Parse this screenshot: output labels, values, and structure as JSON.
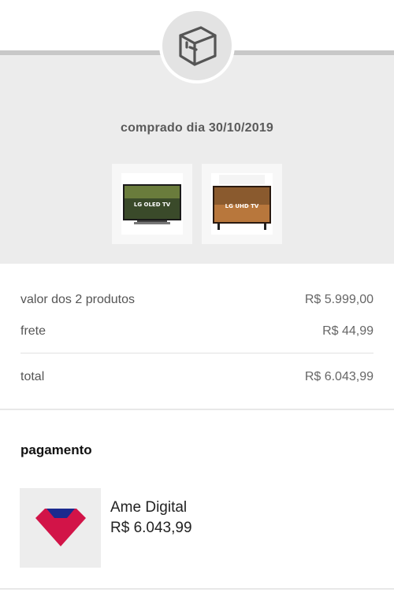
{
  "header": {
    "icon": "package-box-icon",
    "purchase_date": "comprado dia 30/10/2019"
  },
  "products": [
    {
      "name": "LG OLED TV",
      "icon": "tv-product-image"
    },
    {
      "name": "LG UHD TV",
      "icon": "tv-product-image"
    }
  ],
  "summary": {
    "products_label": "valor dos 2 produtos",
    "products_value": "R$ 5.999,00",
    "shipping_label": "frete",
    "shipping_value": "R$ 44,99",
    "total_label": "total",
    "total_value": "R$ 6.043,99"
  },
  "payment": {
    "title": "pagamento",
    "method": "Ame Digital",
    "amount": "R$ 6.043,99",
    "icon": "ame-digital-logo-icon"
  },
  "colors": {
    "band": "#ececec",
    "ame_red": "#d21448",
    "ame_blue": "#1b2a8e"
  }
}
